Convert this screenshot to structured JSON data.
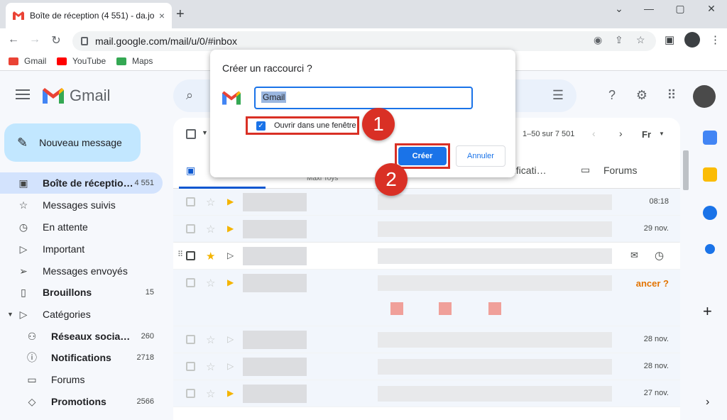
{
  "browser": {
    "tab_title": "Boîte de réception (4 551) - da.jo",
    "tab_close": "×",
    "new_tab": "+",
    "window_minimize": "—",
    "window_maximize": "▢",
    "window_close": "✕",
    "tab_list": "⌄",
    "url": "mail.google.com/mail/u/0/#inbox",
    "back": "←",
    "forward": "→",
    "reload": "↻",
    "bookmarks": [
      {
        "label": "Gmail",
        "icon": "gmail-icon",
        "color": "#ea4335"
      },
      {
        "label": "YouTube",
        "icon": "youtube-icon",
        "color": "#ff0000"
      },
      {
        "label": "Maps",
        "icon": "maps-icon",
        "color": "#34a853"
      }
    ]
  },
  "gmail": {
    "brand": "Gmail",
    "compose_label": "Nouveau message",
    "search_icon": "⌕",
    "filter_icon": "⚙",
    "help_icon": "?",
    "settings_icon": "⚙",
    "apps_icon": "⠿",
    "nav": [
      {
        "label": "Boîte de réceptio…",
        "count": "4 551",
        "icon": "inbox-icon",
        "active": true,
        "bold": true
      },
      {
        "label": "Messages suivis",
        "count": "",
        "icon": "star-icon"
      },
      {
        "label": "En attente",
        "count": "",
        "icon": "clock-icon"
      },
      {
        "label": "Important",
        "count": "",
        "icon": "label-important-icon"
      },
      {
        "label": "Messages envoyés",
        "count": "",
        "icon": "send-icon"
      },
      {
        "label": "Brouillons",
        "count": "15",
        "icon": "draft-icon",
        "bold": true
      },
      {
        "label": "Catégories",
        "count": "",
        "icon": "label-icon"
      },
      {
        "label": "Réseaux socia…",
        "count": "260",
        "icon": "people-icon",
        "bold": true,
        "sub": true
      },
      {
        "label": "Notifications",
        "count": "2718",
        "icon": "info-icon",
        "bold": true,
        "sub": true
      },
      {
        "label": "Forums",
        "count": "",
        "icon": "forum-icon",
        "sub": true
      },
      {
        "label": "Promotions",
        "count": "2566",
        "icon": "tag-icon",
        "bold": true,
        "sub": true
      }
    ],
    "pagination": "1–50 sur 7 501",
    "lang": "Fr",
    "tabs": [
      {
        "label": "Maxi Toys"
      },
      {
        "label": "otificati…"
      },
      {
        "label": "Forums"
      }
    ],
    "rows": [
      {
        "date": "08:18",
        "starred": false,
        "important": true
      },
      {
        "date": "29 nov.",
        "starred": false,
        "important": true
      },
      {
        "date": "",
        "starred": true,
        "important": false
      },
      {
        "date": "ancer ?",
        "starred": false,
        "important": true
      },
      {
        "date": "28 nov.",
        "starred": false,
        "important": false
      },
      {
        "date": "28 nov.",
        "starred": false,
        "important": false
      },
      {
        "date": "27 nov.",
        "starred": false,
        "important": true
      }
    ]
  },
  "dialog": {
    "title": "Créer un raccourci ?",
    "name_value": "Gmail",
    "checkbox_label": "Ouvrir dans une fenêtre",
    "checkbox_checked": true,
    "create_label": "Créer",
    "cancel_label": "Annuler"
  },
  "annotations": {
    "step1": "1",
    "step2": "2"
  },
  "colors": {
    "accent": "#1a73e8",
    "annotation": "#d93025",
    "compose_bg": "#c2e7ff",
    "active_nav": "#d3e3fd"
  }
}
